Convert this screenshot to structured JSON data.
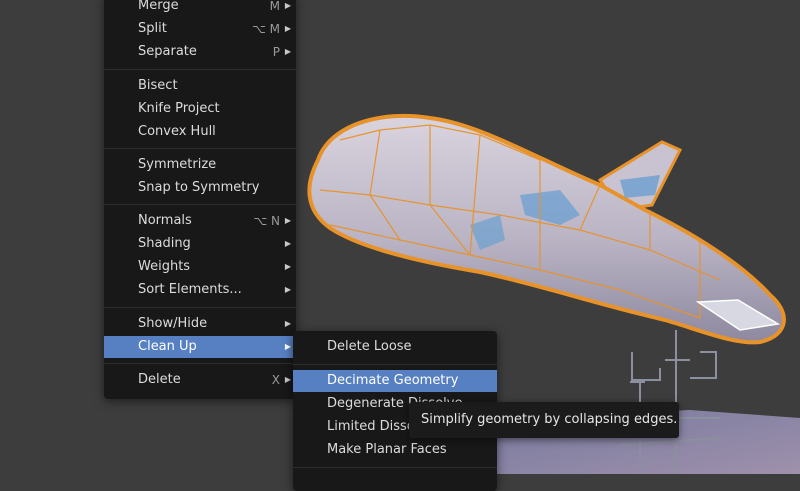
{
  "main_menu": {
    "items": [
      {
        "label": "Merge",
        "shortcut": "M"
      },
      {
        "label": "Split",
        "shortcut": "⌥ M"
      },
      {
        "label": "Separate",
        "shortcut": "P"
      },
      {
        "label": "Bisect"
      },
      {
        "label": "Knife Project"
      },
      {
        "label": "Convex Hull"
      },
      {
        "label": "Symmetrize"
      },
      {
        "label": "Snap to Symmetry"
      },
      {
        "label": "Normals",
        "shortcut": "⌥ N"
      },
      {
        "label": "Shading"
      },
      {
        "label": "Weights"
      },
      {
        "label": "Sort Elements..."
      },
      {
        "label": "Show/Hide"
      },
      {
        "label": "Clean Up",
        "highlighted": true
      },
      {
        "label": "Delete",
        "shortcut": "X"
      }
    ]
  },
  "submenu": {
    "items": [
      {
        "label": "Delete Loose"
      },
      {
        "label": "Decimate Geometry",
        "highlighted": true
      },
      {
        "label": "Degenerate Dissolve"
      },
      {
        "label": "Limited Dissolve"
      },
      {
        "label": "Make Planar Faces"
      }
    ]
  },
  "tooltip": {
    "text": "Simplify geometry by collapsing edges."
  },
  "colors": {
    "menu_background": "#181818",
    "highlight": "#5680c2",
    "selection_outline": "#e8922a",
    "viewport_background": "#3d3d3d"
  },
  "icons": [
    "submenu-arrow-icon"
  ]
}
